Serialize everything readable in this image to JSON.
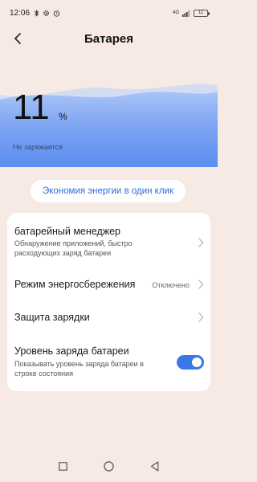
{
  "status_bar": {
    "time": "12:06",
    "net_label": "4G",
    "battery_level": "11"
  },
  "header": {
    "title": "Батарея"
  },
  "battery": {
    "percent": "11",
    "unit": "%",
    "status": "Не заряжается",
    "wave_color": "#5b8ef0"
  },
  "one_click_label": "Экономия энергии в один клик",
  "settings": {
    "manager": {
      "title": "батарейный менеджер",
      "subtitle_line1": "Обнаружение приложений, быстро",
      "subtitle_line2": "расходующих заряд батареи"
    },
    "power_saving": {
      "title": "Режим энергосбережения",
      "value": "Отключено"
    },
    "charge_protection": {
      "title": "Защита зарядки"
    },
    "battery_level": {
      "title": "Уровень заряда батареи",
      "subtitle_line1": "Показывать уровень заряда батареи в",
      "subtitle_line2": "строке состояния",
      "enabled": true
    }
  },
  "colors": {
    "accent": "#3b78e7",
    "link": "#2f6fd9",
    "background": "#f7e9e4"
  }
}
